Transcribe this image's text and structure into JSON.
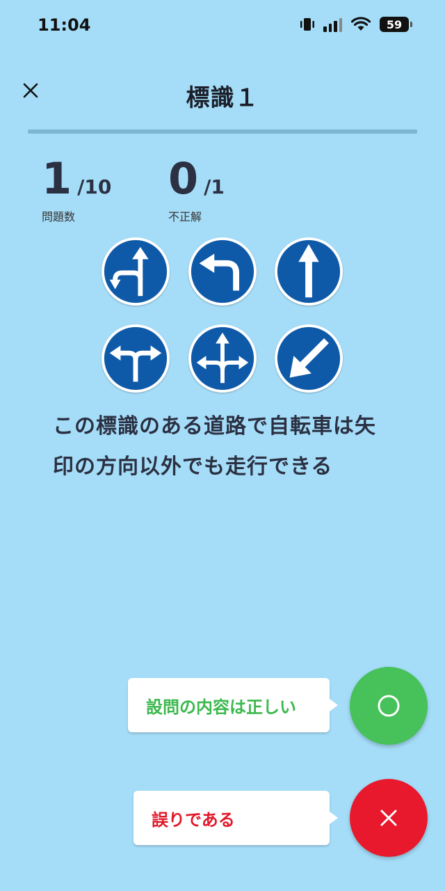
{
  "status_bar": {
    "time": "11:04",
    "battery": "59"
  },
  "header": {
    "title": "標識１",
    "close_icon": "close-icon"
  },
  "progress": {
    "value": 0.1
  },
  "stats": {
    "question_count": {
      "value": "1",
      "total": "/10",
      "label": "問題数"
    },
    "incorrect": {
      "value": "0",
      "total": "/1",
      "label": "不正解"
    }
  },
  "signs": [
    {
      "name": "straight-and-left-turn-sign-icon"
    },
    {
      "name": "left-turn-sign-icon"
    },
    {
      "name": "straight-ahead-sign-icon"
    },
    {
      "name": "left-right-turn-sign-icon"
    },
    {
      "name": "straight-left-right-sign-icon"
    },
    {
      "name": "keep-left-diagonal-sign-icon"
    }
  ],
  "question": {
    "line1": "この標識のある道路で自転車は矢",
    "line2": "印の方向以外でも走行できる"
  },
  "answers": {
    "true_label": "設問の内容は正しい",
    "false_label": "誤りである",
    "true_icon": "circle-icon",
    "false_icon": "cross-icon"
  },
  "colors": {
    "background": "#a5ddf8",
    "sign_blue": "#0f5aa8",
    "true_green": "#47c15a",
    "false_red": "#e8192c"
  }
}
